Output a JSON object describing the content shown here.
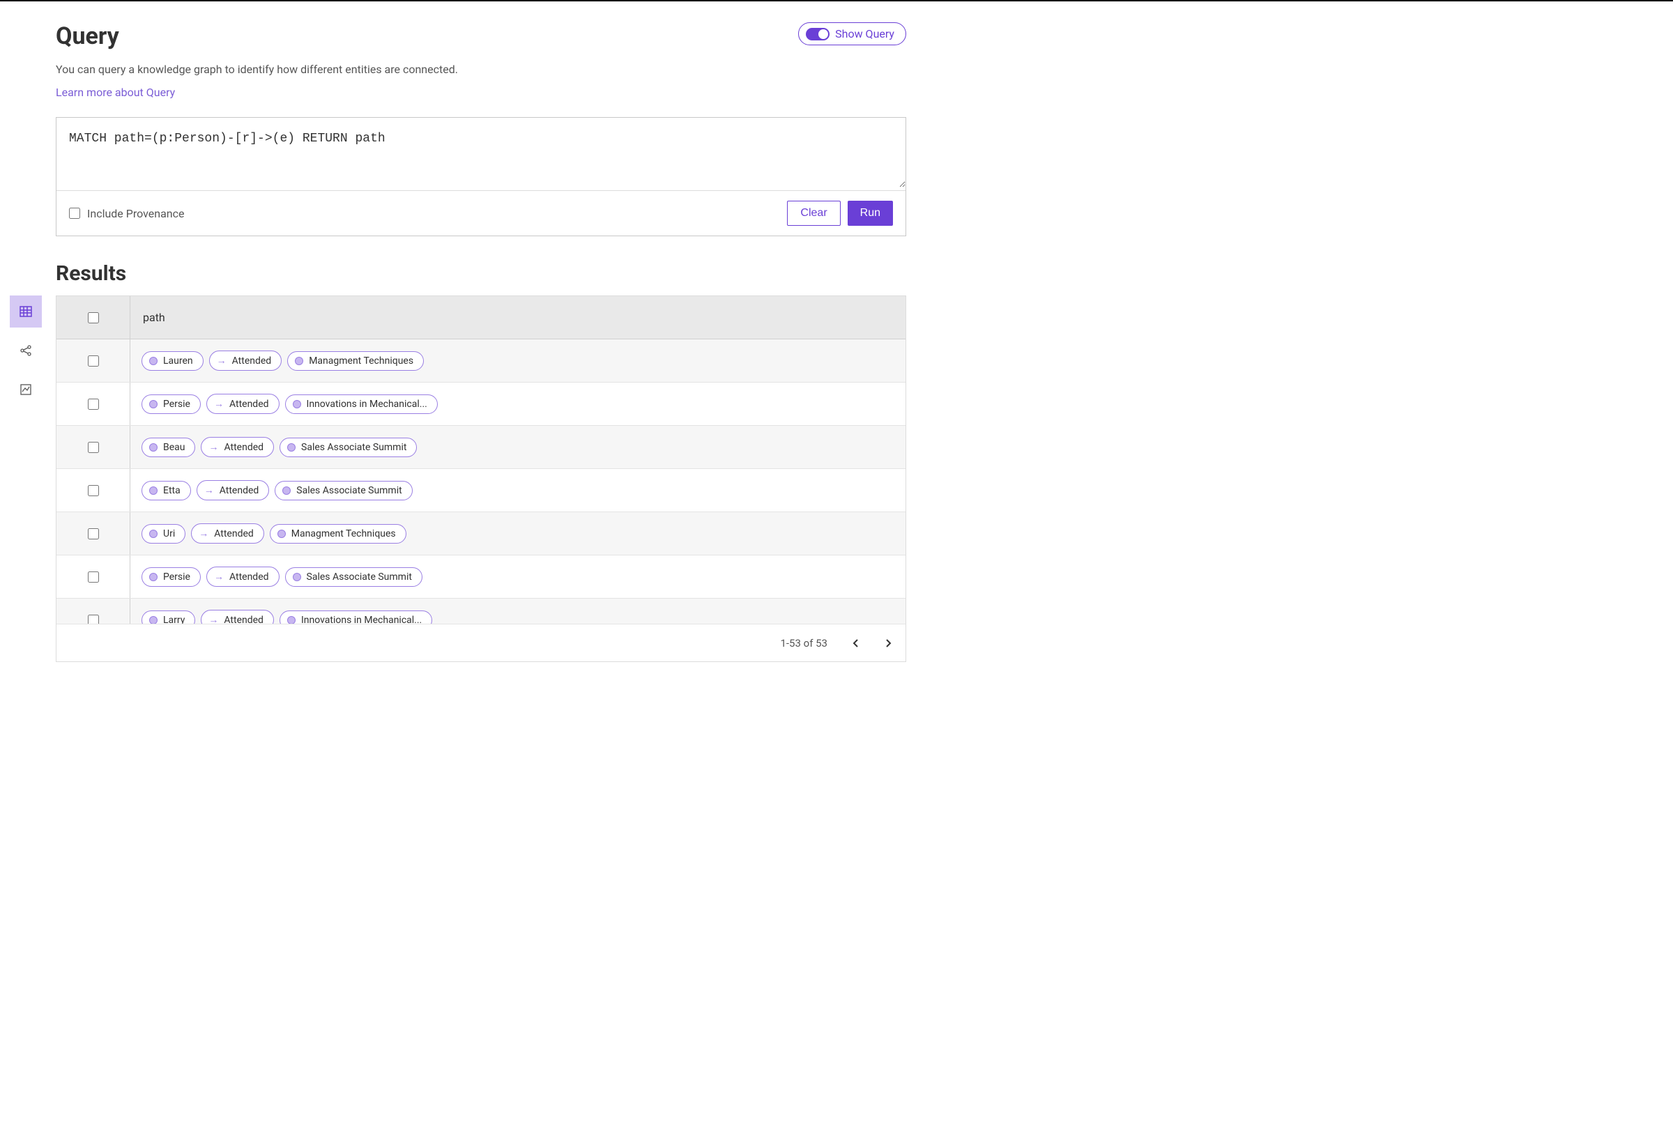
{
  "header": {
    "title": "Query",
    "description": "You can query a knowledge graph to identify how different entities are connected.",
    "learn_link": "Learn more about Query",
    "show_query_label": "Show Query"
  },
  "query": {
    "text": "MATCH path=(p:Person)-[r]->(e) RETURN path",
    "include_provenance_label": "Include Provenance",
    "clear_label": "Clear",
    "run_label": "Run"
  },
  "results": {
    "title": "Results",
    "column_header": "path",
    "rows": [
      {
        "person": "Lauren",
        "relation": "Attended",
        "event": "Managment Techniques"
      },
      {
        "person": "Persie",
        "relation": "Attended",
        "event": "Innovations in Mechanical..."
      },
      {
        "person": "Beau",
        "relation": "Attended",
        "event": "Sales Associate Summit"
      },
      {
        "person": "Etta",
        "relation": "Attended",
        "event": "Sales Associate Summit"
      },
      {
        "person": "Uri",
        "relation": "Attended",
        "event": "Managment Techniques"
      },
      {
        "person": "Persie",
        "relation": "Attended",
        "event": "Sales Associate Summit"
      },
      {
        "person": "Larry",
        "relation": "Attended",
        "event": "Innovations in Mechanical..."
      }
    ],
    "pager": "1-53 of 53"
  }
}
